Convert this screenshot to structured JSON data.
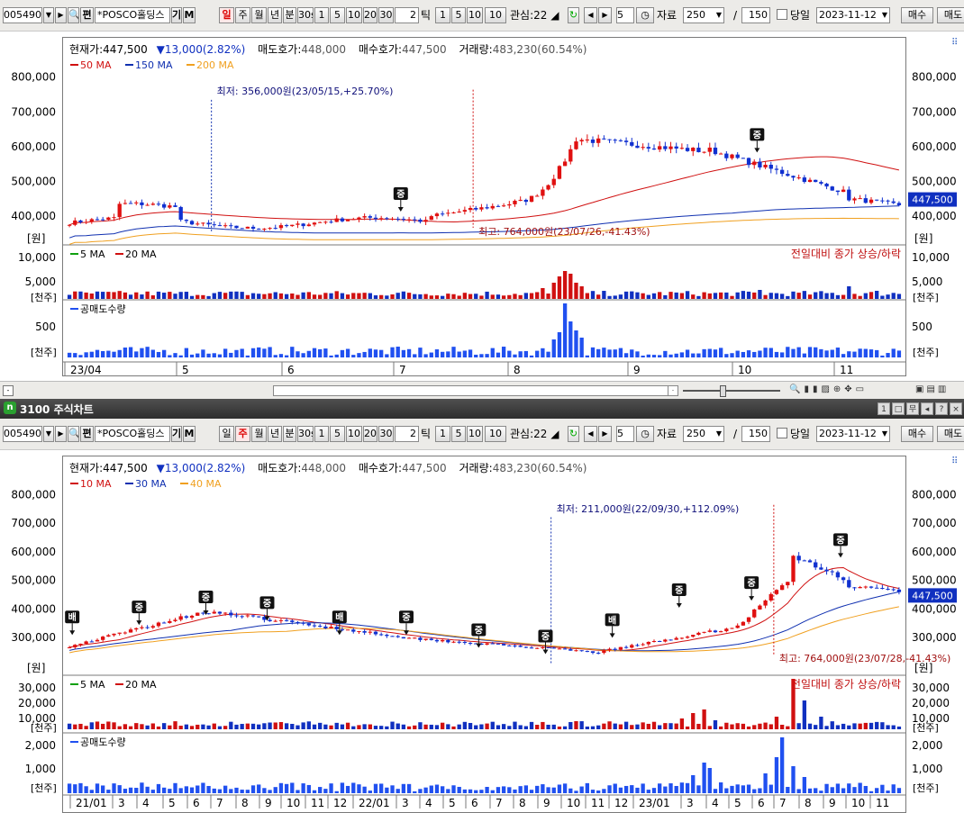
{
  "top": {
    "toolbar": {
      "code": "005490",
      "name": "*POSCO홀딩스",
      "chr1": "기",
      "chr2": "M",
      "periods": [
        "일",
        "주",
        "월",
        "년",
        "분",
        "30s",
        "1",
        "5",
        "10",
        "20",
        "30"
      ],
      "active_period": "일",
      "count": "2",
      "tick": "틱",
      "ticks": [
        "1",
        "5",
        "10",
        "10"
      ],
      "watch": "관심:22 ◢",
      "num": "5",
      "data_label": "자료",
      "data_count": "250",
      "slash": "/",
      "view": "150",
      "same_day": "당일",
      "date": "2023-11-12",
      "buy": "매수",
      "sell": "매도"
    },
    "info": {
      "price_label": "현재가:",
      "price": "447,500",
      "change": "13,000(2.82%)",
      "ask_label": "매도호가:",
      "ask": "448,000",
      "bid_label": "매수호가:",
      "bid": "447,500",
      "volume_label": "거래량:",
      "volume": "483,230(60.54%)"
    },
    "legend": [
      {
        "name": "50 MA",
        "color": "#d01010"
      },
      {
        "name": "150 MA",
        "color": "#1030b0"
      },
      {
        "name": "200 MA",
        "color": "#f0a020"
      }
    ],
    "y_ticks": [
      "800,000",
      "700,000",
      "600,000",
      "500,000",
      "400,000"
    ],
    "unit_price": "[원]",
    "current_tag": "447,500",
    "low_note": "최저:  356,000원(23/05/15,+25.70%)",
    "high_note": "최고:  764,000원(23/07/26,-41.43%)",
    "vol_legend": [
      {
        "name": "5 MA",
        "color": "#10a010"
      },
      {
        "name": "20 MA",
        "color": "#d01010"
      }
    ],
    "vol_note": "전일대비 종가 상승/하락",
    "vol_ticks": [
      "10,000",
      "5,000"
    ],
    "unit_vol": "[천주]",
    "short_label": "공매도수량",
    "short_ticks": [
      "500"
    ],
    "unit_short": "[천주]",
    "x_labels": [
      "23/04",
      "5",
      "6",
      "7",
      "8",
      "9",
      "10",
      "11"
    ],
    "chart_data": {
      "type": "candlestick",
      "ylim": [
        340000,
        820000
      ],
      "ma": [
        "50 MA",
        "150 MA",
        "200 MA"
      ],
      "low": {
        "value": 356000,
        "date": "23/05/15"
      },
      "high": {
        "value": 764000,
        "date": "23/07/26"
      },
      "current": 447500
    }
  },
  "bottom": {
    "window_title": "3100 주식차트",
    "title_buttons": [
      "1",
      "□",
      "무",
      "◂",
      "?",
      "×"
    ],
    "toolbar": {
      "code": "005490",
      "name": "*POSCO홀딩스",
      "chr1": "기",
      "chr2": "M",
      "periods": [
        "일",
        "주",
        "월",
        "년",
        "분",
        "30s",
        "1",
        "5",
        "10",
        "20",
        "30"
      ],
      "active_period": "주",
      "count": "2",
      "tick": "틱",
      "ticks": [
        "1",
        "5",
        "10",
        "10"
      ],
      "watch": "관심:22 ◢",
      "num": "5",
      "data_label": "자료",
      "data_count": "250",
      "slash": "/",
      "view": "150",
      "same_day": "당일",
      "date": "2023-11-12",
      "buy": "매수",
      "sell": "매도"
    },
    "info": {
      "price_label": "현재가:",
      "price": "447,500",
      "change": "13,000(2.82%)",
      "ask_label": "매도호가:",
      "ask": "448,000",
      "bid_label": "매수호가:",
      "bid": "447,500",
      "volume_label": "거래량:",
      "volume": "483,230(60.54%)"
    },
    "legend": [
      {
        "name": "10 MA",
        "color": "#d01010"
      },
      {
        "name": "30 MA",
        "color": "#1030b0"
      },
      {
        "name": "40 MA",
        "color": "#f0a020"
      }
    ],
    "y_ticks": [
      "800,000",
      "700,000",
      "600,000",
      "500,000",
      "400,000",
      "300,000"
    ],
    "unit_price": "[원]",
    "current_tag": "447,500",
    "low_note": "최저:  211,000원(22/09/30,+112.09%)",
    "high_note": "최고:  764,000원(23/07/28,-41.43%)",
    "vol_legend": [
      {
        "name": "5 MA",
        "color": "#10a010"
      },
      {
        "name": "20 MA",
        "color": "#d01010"
      }
    ],
    "vol_note": "전일대비 종가 상승/하락",
    "vol_ticks": [
      "30,000",
      "20,000",
      "10,000"
    ],
    "unit_vol": "[천주]",
    "short_label": "공매도수량",
    "short_ticks": [
      "2,000",
      "1,000"
    ],
    "unit_short": "[천주]",
    "x_labels": [
      "21/01",
      "3",
      "4",
      "5",
      "6",
      "7",
      "8",
      "9",
      "10",
      "11",
      "12",
      "22/01",
      "3",
      "4",
      "5",
      "6",
      "7",
      "8",
      "9",
      "10",
      "11",
      "12",
      "23/01",
      "3",
      "4",
      "5",
      "6",
      "7",
      "8",
      "9",
      "10",
      "11"
    ],
    "chart_data": {
      "type": "candlestick",
      "ylim": [
        200000,
        820000
      ],
      "ma": [
        "10 MA",
        "30 MA",
        "40 MA"
      ],
      "low": {
        "value": 211000,
        "date": "22/09/30"
      },
      "high": {
        "value": 764000,
        "date": "23/07/28"
      },
      "current": 447500
    }
  }
}
